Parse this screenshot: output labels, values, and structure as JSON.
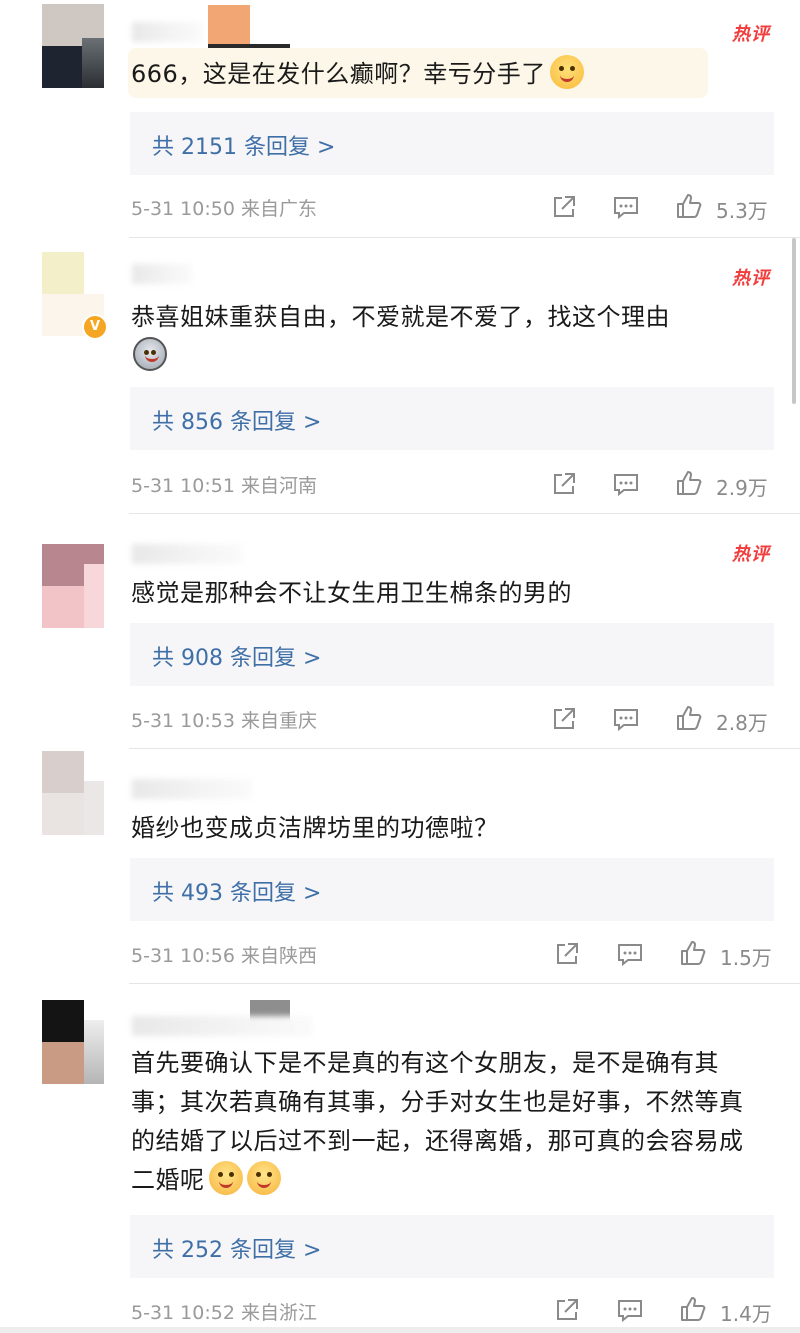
{
  "comments": [
    {
      "text": "666，这是在发什么癫啊？幸亏分手了",
      "emoji": "blush-heart-emoji",
      "hot_badge": "热评",
      "replies_label": "共 2151 条回复 >",
      "time": "5-31 10:50",
      "location": "来自广东",
      "likes": "5.3万"
    },
    {
      "text": "恭喜姐妹重获自由，不爱就是不爱了，找这个理由",
      "emoji": "husky-dog-emoji",
      "hot_badge": "热评",
      "replies_label": "共 856 条回复 >",
      "time": "5-31 10:51",
      "location": "来自河南",
      "likes": "2.9万"
    },
    {
      "text": "感觉是那种会不让女生用卫生棉条的男的",
      "hot_badge": "热评",
      "replies_label": "共 908 条回复 >",
      "time": "5-31 10:53",
      "location": "来自重庆",
      "likes": "2.8万"
    },
    {
      "text": "婚纱也变成贞洁牌坊里的功德啦？",
      "replies_label": "共 493 条回复 >",
      "time": "5-31 10:56",
      "location": "来自陕西",
      "likes": "1.5万"
    },
    {
      "text": "首先要确认下是不是真的有这个女朋友，是不是确有其事；其次若真确有其事，分手对女生也是好事，不然等真的结婚了以后过不到一起，还得离婚，那可真的会容易成二婚呢",
      "emoji": "smile-emoji",
      "replies_label": "共 252 条回复 >",
      "time": "5-31 10:52",
      "location": "来自浙江",
      "likes": "1.4万"
    }
  ],
  "colors": {
    "hot_badge": "#f23d3d",
    "reply_link": "#3f6fa7",
    "meta_text": "#9a9a9a",
    "reply_bg": "#f6f6f8"
  },
  "icons": [
    "share-icon",
    "comment-icon",
    "like-icon",
    "verified-badge-icon"
  ]
}
